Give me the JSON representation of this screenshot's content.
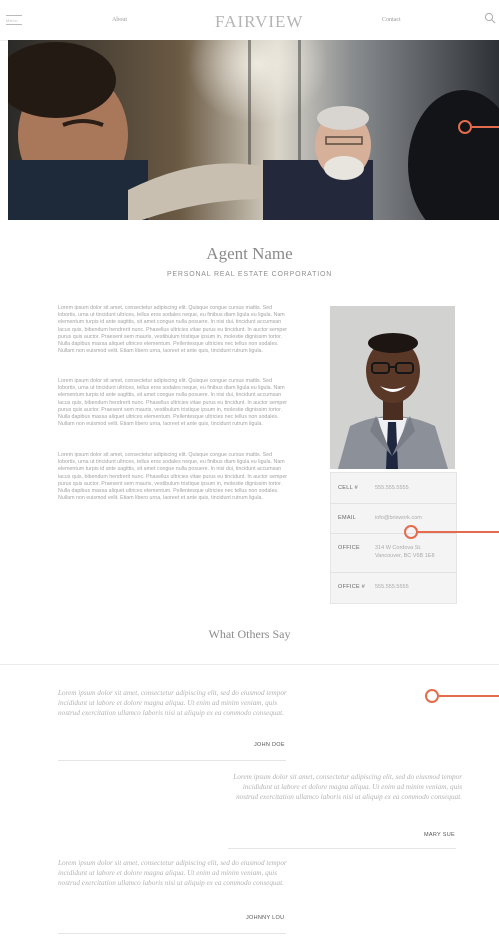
{
  "header": {
    "menu_label": "Menu",
    "about": "About",
    "logo": "FAIRVIEW",
    "contact": "Contact"
  },
  "colors": {
    "accent": "#e46b4c",
    "text_muted": "#a3a3a3"
  },
  "agent": {
    "name": "Agent Name",
    "subtitle": "PERSONAL REAL ESTATE CORPORATION"
  },
  "bio": {
    "paragraphs": [
      "Lorem ipsum dolor sit amet, consectetur adipiscing elit. Quisque congue cursus mattis. Sed lobortis, urna ut tincidunt ultrices, tellus eros sodales neque, eu finibus diam ligula eu ligula. Nam elementum turpis id ante sagittis, sit amet congue nulla posuere. In nisi dui, tincidunt accumsan lacus quis, bibendum hendrerit nunc. Phasellus ultricies vitae purus eu tincidunt. In auctor semper purus quis auctor. Praesent sem mauris, vestibulum tristique ipsum in, molestie dignissim tortor. Nulla dapibus massa aliquet ultrices elementum. Pellentesque ultricies nec tellus non sodales. Nullam non euismod velit. Etiam libero urna, laoreet et ante quis, tincidunt rutrum ligula.",
      "Lorem ipsum dolor sit amet, consectetur adipiscing elit. Quisque congue cursus mattis. Sed lobortis, urna ut tincidunt ultrices, tellus eros sodales neque, eu finibus diam ligula eu ligula. Nam elementum turpis id ante sagittis, sit amet congue nulla posuere. In nisi dui, tincidunt accumsan lacus quis, bibendum hendrerit nunc. Phasellus ultricies vitae purus eu tincidunt. In auctor semper purus quis auctor. Praesent sem mauris, vestibulum tristique ipsum in, molestie dignissim tortor. Nulla dapibus massa aliquet ultrices elementum. Pellentesque ultricies nec tellus non sodales. Nullam non euismod velit. Etiam libero urna, laoreet et ante quis, tincidunt rutrum ligula.",
      "Lorem ipsum dolor sit amet, consectetur adipiscing elit. Quisque congue cursus mattis. Sed lobortis, urna ut tincidunt ultrices, tellus eros sodales neque, eu finibus diam ligula eu ligula. Nam elementum turpis id ante sagittis, sit amet congue nulla posuere. In nisi dui, tincidunt accumsan lacus quis, bibendum hendrerit nunc. Phasellus ultricies vitae purus eu tincidunt. In auctor semper purus quis auctor. Praesent sem mauris, vestibulum tristique ipsum in, molestie dignissim tortor. Nulla dapibus massa aliquet ultrices elementum. Pellentesque ultricies nec tellus non sodales. Nullam non euismod velit. Etiam libero urna, laoreet et ante quis, tincidunt rutrum ligula."
    ]
  },
  "contact": {
    "rows": [
      {
        "label": "CELL #",
        "value": "555.555.5555"
      },
      {
        "label": "EMAIL",
        "value": "info@brixwork.com"
      },
      {
        "label": "OFFICE",
        "value": "314 W Cordova St.",
        "value2": "Vancouver, BC V6B 1E8"
      },
      {
        "label": "OFFICE #",
        "value": "555.555.5555"
      }
    ]
  },
  "testimonials": {
    "title": "What Others Say",
    "items": [
      {
        "quote": "Lorem ipsum dolor sit amet, consectetur adipiscing elit, sed do eiusmod tempor incididunt ut labore et dolore magna aliqua. Ut enim ad minim veniam, quis nostrud exercitation ullamco laboris nisi ut aliquip ex ea commodo consequat.",
        "author": "JOHN DOE"
      },
      {
        "quote": "Lorem ipsum dolor sit amet, consectetur adipiscing elit, sed do eiusmod tempor incididunt ut labore et dolore magna aliqua. Ut enim ad minim veniam, quis nostrud exercitation ullamco laboris nisi ut aliquip ex ea commodo consequat.",
        "author": "MARY SUE"
      },
      {
        "quote": "Lorem ipsum dolor sit amet, consectetur adipiscing elit, sed do eiusmod tempor incididunt ut labore et dolore magna aliqua. Ut enim ad minim veniam, quis nostrud exercitation ullamco laboris nisi ut aliquip ex ea commodo consequat.",
        "author": "JOHNNY LOU"
      }
    ]
  }
}
